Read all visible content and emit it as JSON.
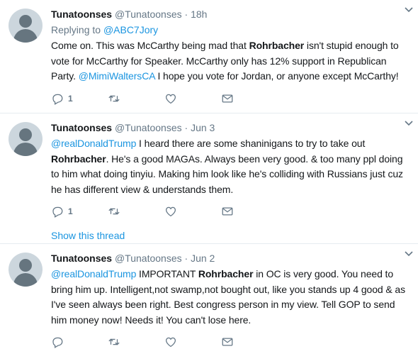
{
  "tweets": [
    {
      "fullname": "Tunatoonses",
      "username": "@Tunatoonses",
      "dot": "·",
      "time": "18h",
      "replying_prefix": "Replying to ",
      "replying_to": "@ABC7Jory",
      "text_parts": [
        {
          "t": "Come on. This was McCarthy being mad that "
        },
        {
          "t": "Rohrbacher",
          "b": true
        },
        {
          "t": " isn't stupid enough to vote for McCarthy for Speaker. McCarthy only has 12% support in Republican Party. "
        },
        {
          "t": "@MimiWaltersCA",
          "link": true
        },
        {
          "t": " I hope you vote for Jordan, or anyone except McCarthy!"
        }
      ],
      "reply_count": "1",
      "retweet_count": "",
      "like_count": ""
    },
    {
      "fullname": "Tunatoonses",
      "username": "@Tunatoonses",
      "dot": "·",
      "time": "Jun 3",
      "text_parts": [
        {
          "t": "@realDonaldTrump",
          "link": true
        },
        {
          "t": " I heard there are some shaninigans to try to take out "
        },
        {
          "t": "Rohrbacher",
          "b": true
        },
        {
          "t": ". He's a good MAGAs. Always been very good. & too many ppl doing to him what doing tinyiu. Making him look like he's colliding with Russians just cuz he has different view & understands them."
        }
      ],
      "reply_count": "1",
      "retweet_count": "",
      "like_count": "",
      "show_thread": "Show this thread"
    },
    {
      "fullname": "Tunatoonses",
      "username": "@Tunatoonses",
      "dot": "·",
      "time": "Jun 2",
      "text_parts": [
        {
          "t": "@realDonaldTrump",
          "link": true
        },
        {
          "t": " IMPORTANT "
        },
        {
          "t": "Rohrbacher",
          "b": true
        },
        {
          "t": " in OC is very good. You need to bring him up. Intelligent,not swamp,not bought out, like you stands up 4 good & as I've seen always been right. Best congress person in my view. Tell GOP to send him money now! Needs it! You can't lose here."
        }
      ],
      "reply_count": "",
      "retweet_count": "",
      "like_count": ""
    }
  ],
  "icons": {
    "reply": "reply-icon",
    "retweet": "retweet-icon",
    "like": "heart-icon",
    "dm": "envelope-icon",
    "more": "chevron-down-icon"
  },
  "colors": {
    "link": "#1b95e0",
    "secondary_text": "#657786",
    "divider": "#e6ecf0",
    "avatar_bg": "#ccd6dd"
  }
}
